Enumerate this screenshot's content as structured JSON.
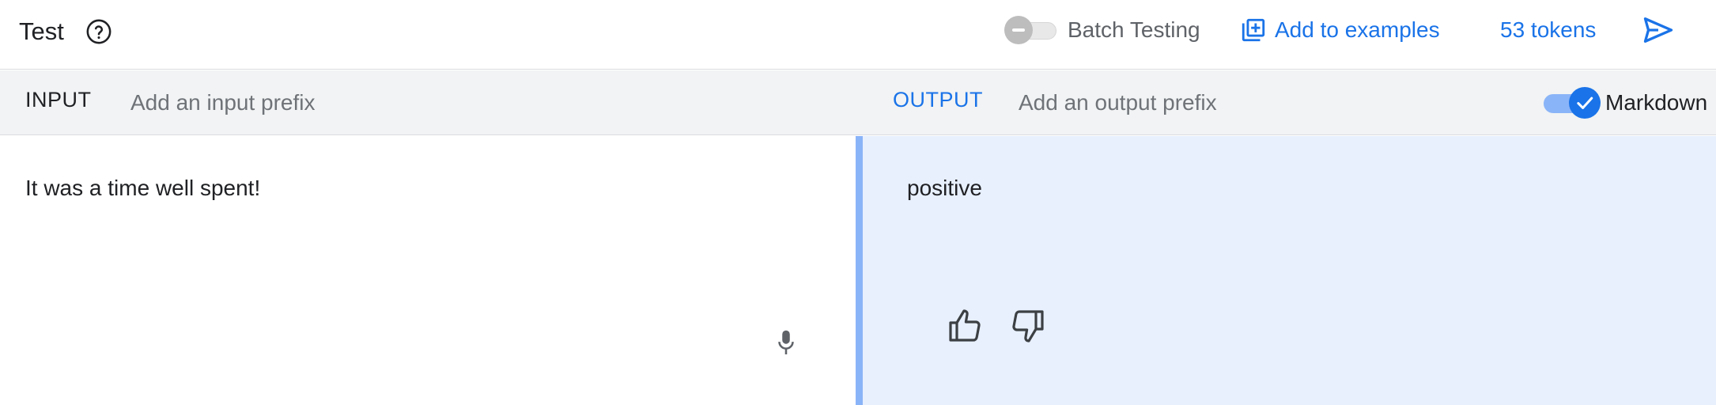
{
  "header": {
    "title": "Test",
    "batch_testing_label": "Batch Testing",
    "batch_testing_enabled": false,
    "add_examples_label": "Add to examples",
    "tokens_label": "53 tokens"
  },
  "prefix_bar": {
    "input_label": "INPUT",
    "input_prefix_placeholder": "Add an input prefix",
    "output_label": "OUTPUT",
    "output_prefix_placeholder": "Add an output prefix",
    "markdown_label": "Markdown",
    "markdown_enabled": true
  },
  "input": {
    "text": "It was a time well spent!"
  },
  "output": {
    "text": "positive"
  },
  "colors": {
    "accent": "#1a73e8",
    "output_background": "#e8f0fe",
    "output_border": "#8ab4f8",
    "prefix_bar_background": "#f1f3f4"
  },
  "icons": {
    "help": "help-circle-icon",
    "add_examples": "library-add-icon",
    "send": "send-icon",
    "mic": "microphone-icon",
    "thumb_up": "thumb-up-icon",
    "thumb_down": "thumb-down-icon",
    "check": "check-icon"
  }
}
